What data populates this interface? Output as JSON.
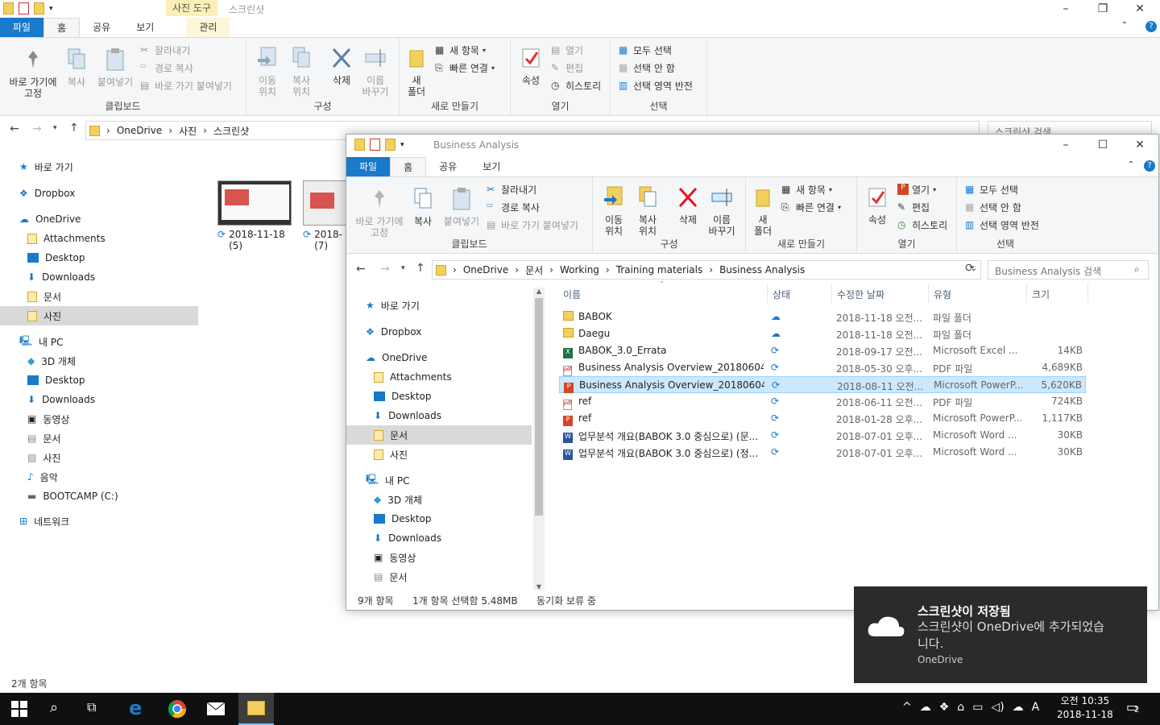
{
  "back_window": {
    "title_tool": "사진 도구",
    "title": "스크린샷",
    "tabs": [
      "파일",
      "홈",
      "공유",
      "보기"
    ],
    "manage_tab": "관리",
    "ribbon": {
      "pin_label": "바로 가기에\n고정",
      "copy_label": "복사",
      "paste_label": "붙여넣기",
      "cut_label": "잘라내기",
      "copy_path_label": "경로 복사",
      "paste_shortcut_label": "바로 가기 붙여넣기",
      "clipboard_group": "클립보드",
      "move_to_label": "이동\n위치",
      "copy_to_label": "복사\n위치",
      "delete_label": "삭제",
      "rename_label": "이름\n바꾸기",
      "organize_group": "구성",
      "new_folder_label": "새\n폴더",
      "new_item_label": "새 항목",
      "easy_access_label": "빠른 연결",
      "new_group": "새로 만들기",
      "properties_label": "속성",
      "open_label": "열기",
      "edit_label": "편집",
      "history_label": "히스토리",
      "open_group": "열기",
      "select_all_label": "모두 선택",
      "select_none_label": "선택 안 함",
      "invert_selection_label": "선택 영역 반전",
      "select_group": "선택"
    },
    "address": [
      "OneDrive",
      "사진",
      "스크린샷"
    ],
    "search_placeholder": "스크린샷 검색",
    "nav": {
      "quick_access": "바로 가기",
      "dropbox": "Dropbox",
      "onedrive": "OneDrive",
      "onedrive_items": [
        "Attachments",
        "Desktop",
        "Downloads",
        "문서",
        "사진"
      ],
      "this_pc": "내 PC",
      "pc_items": [
        "3D 개체",
        "Desktop",
        "Downloads",
        "동영상",
        "문서",
        "사진",
        "음악",
        "BOOTCAMP (C:)"
      ],
      "network": "네트워크"
    },
    "thumbnails": [
      {
        "label": "2018-11-18\n(5)"
      },
      {
        "label": "2018-\n(7)"
      }
    ],
    "status": "2개 항목"
  },
  "front_window": {
    "title": "Business Analysis",
    "tabs": [
      "파일",
      "홈",
      "공유",
      "보기"
    ],
    "ribbon": {
      "pin_label": "바로 가기에\n고정",
      "copy_label": "복사",
      "paste_label": "붙여넣기",
      "cut_label": "잘라내기",
      "copy_path_label": "경로 복사",
      "paste_shortcut_label": "바로 가기 붙여넣기",
      "clipboard_group": "클립보드",
      "move_to_label": "이동\n위치",
      "copy_to_label": "복사\n위치",
      "delete_label": "삭제",
      "rename_label": "이름\n바꾸기",
      "organize_group": "구성",
      "new_folder_label": "새\n폴더",
      "new_item_label": "새 항목",
      "easy_access_label": "빠른 연결",
      "new_group": "새로 만들기",
      "properties_label": "속성",
      "open_label": "열기",
      "edit_label": "편집",
      "history_label": "히스토리",
      "open_group": "열기",
      "select_all_label": "모두 선택",
      "select_none_label": "선택 안 함",
      "invert_selection_label": "선택 영역 반전",
      "select_group": "선택"
    },
    "address": [
      "OneDrive",
      "문서",
      "Working",
      "Training materials",
      "Business Analysis"
    ],
    "search_placeholder": "Business Analysis 검색",
    "nav": {
      "quick_access": "바로 가기",
      "dropbox": "Dropbox",
      "onedrive": "OneDrive",
      "onedrive_items": [
        "Attachments",
        "Desktop",
        "Downloads",
        "문서",
        "사진"
      ],
      "this_pc": "내 PC",
      "pc_items": [
        "3D 개체",
        "Desktop",
        "Downloads",
        "동영상",
        "문서"
      ]
    },
    "columns": [
      "이름",
      "상태",
      "수정한 날짜",
      "유형",
      "크기"
    ],
    "files": [
      {
        "name": "BABOK",
        "date": "2018-11-18 오전...",
        "type": "파일 폴더",
        "size": "",
        "icon": "folder-icon",
        "status": "cloud-icon"
      },
      {
        "name": "Daegu",
        "date": "2018-11-18 오전...",
        "type": "파일 폴더",
        "size": "",
        "icon": "folder-icon",
        "status": "cloud-icon"
      },
      {
        "name": "BABOK_3.0_Errata",
        "date": "2018-09-17 오전...",
        "type": "Microsoft Excel ...",
        "size": "14KB",
        "icon": "excel-icon",
        "status": "sync-icon"
      },
      {
        "name": "Business Analysis Overview_20180604 (...",
        "date": "2018-05-30 오후...",
        "type": "PDF 파일",
        "size": "4,689KB",
        "icon": "pdf-icon",
        "status": "sync-icon"
      },
      {
        "name": "Business Analysis Overview_20180604 (...",
        "date": "2018-08-11 오전...",
        "type": "Microsoft PowerP...",
        "size": "5,620KB",
        "icon": "powerpoint-icon",
        "status": "sync-icon"
      },
      {
        "name": "ref",
        "date": "2018-06-11 오전...",
        "type": "PDF 파일",
        "size": "724KB",
        "icon": "pdf-icon",
        "status": "sync-icon"
      },
      {
        "name": "ref",
        "date": "2018-01-28 오후...",
        "type": "Microsoft PowerP...",
        "size": "1,117KB",
        "icon": "powerpoint-icon",
        "status": "sync-icon"
      },
      {
        "name": "업무분석 개요(BABOK 3.0 중심으로) (문...",
        "date": "2018-07-01 오후...",
        "type": "Microsoft Word ...",
        "size": "30KB",
        "icon": "word-icon",
        "status": "sync-icon"
      },
      {
        "name": "업무분석 개요(BABOK 3.0 중심으로) (정...",
        "date": "2018-07-01 오후...",
        "type": "Microsoft Word ...",
        "size": "30KB",
        "icon": "word-icon",
        "status": "sync-icon"
      }
    ],
    "status": {
      "count": "9개 항목",
      "selected": "1개 항목 선택함 5.48MB",
      "sync": "동기화 보류 중"
    }
  },
  "toast": {
    "title": "스크린샷이 저장됨",
    "body": "스크린샷이 OneDrive에 추가되었습\n니다.",
    "source": "OneDrive"
  },
  "taskbar": {
    "time": "오전 10:35",
    "date": "2018-11-18",
    "ime": "A",
    "notifications": "2"
  },
  "colors": {
    "accent": "#1979ca",
    "selection": "#cce8ff",
    "taskbar": "#101010",
    "toast": "#2b2b2b"
  }
}
